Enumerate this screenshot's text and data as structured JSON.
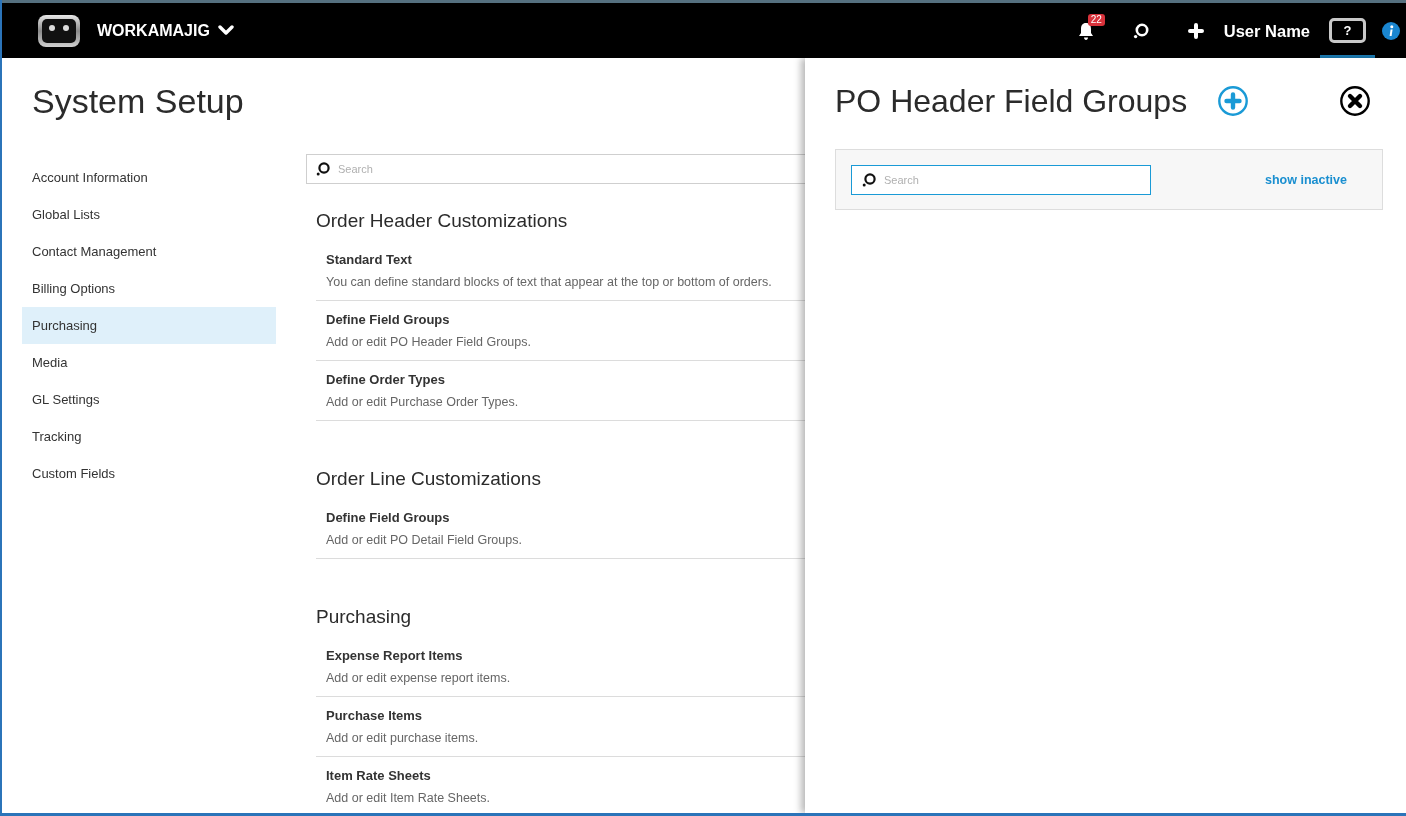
{
  "app_bar": {
    "product": "WORKAMAJIG",
    "notifications": {
      "count": "22"
    },
    "user_name": "User Name",
    "help": {
      "label": "?",
      "selected": true
    }
  },
  "page": {
    "title": "System Setup",
    "search": {
      "placeholder": "Search"
    }
  },
  "sidebar": {
    "items": [
      {
        "label": "Account Information",
        "selected": false
      },
      {
        "label": "Global Lists",
        "selected": false
      },
      {
        "label": "Contact Management",
        "selected": false
      },
      {
        "label": "Billing Options",
        "selected": false
      },
      {
        "label": "Purchasing",
        "selected": true
      },
      {
        "label": "Media",
        "selected": false
      },
      {
        "label": "GL Settings",
        "selected": false
      },
      {
        "label": "Tracking",
        "selected": false
      },
      {
        "label": "Custom Fields",
        "selected": false
      }
    ]
  },
  "sections": [
    {
      "heading": "Order Header Customizations",
      "items": [
        {
          "title": "Standard Text",
          "description": "You can define standard blocks of text that appear at the top or bottom of orders."
        },
        {
          "title": "Define Field Groups",
          "description": "Add or edit PO Header Field Groups."
        },
        {
          "title": "Define Order Types",
          "description": "Add or edit Purchase Order Types."
        }
      ]
    },
    {
      "heading": "Order Line Customizations",
      "items": [
        {
          "title": "Define Field Groups",
          "description": "Add or edit PO Detail Field Groups."
        }
      ]
    },
    {
      "heading": "Purchasing",
      "items": [
        {
          "title": "Expense Report Items",
          "description": "Add or edit expense report items."
        },
        {
          "title": "Purchase Items",
          "description": "Add or edit purchase items."
        },
        {
          "title": "Item Rate Sheets",
          "description": "Add or edit Item Rate Sheets."
        }
      ]
    }
  ],
  "panel": {
    "title": "PO Header Field Groups",
    "search": {
      "placeholder": "Search",
      "focused": true
    },
    "show_inactive": "show inactive"
  }
}
